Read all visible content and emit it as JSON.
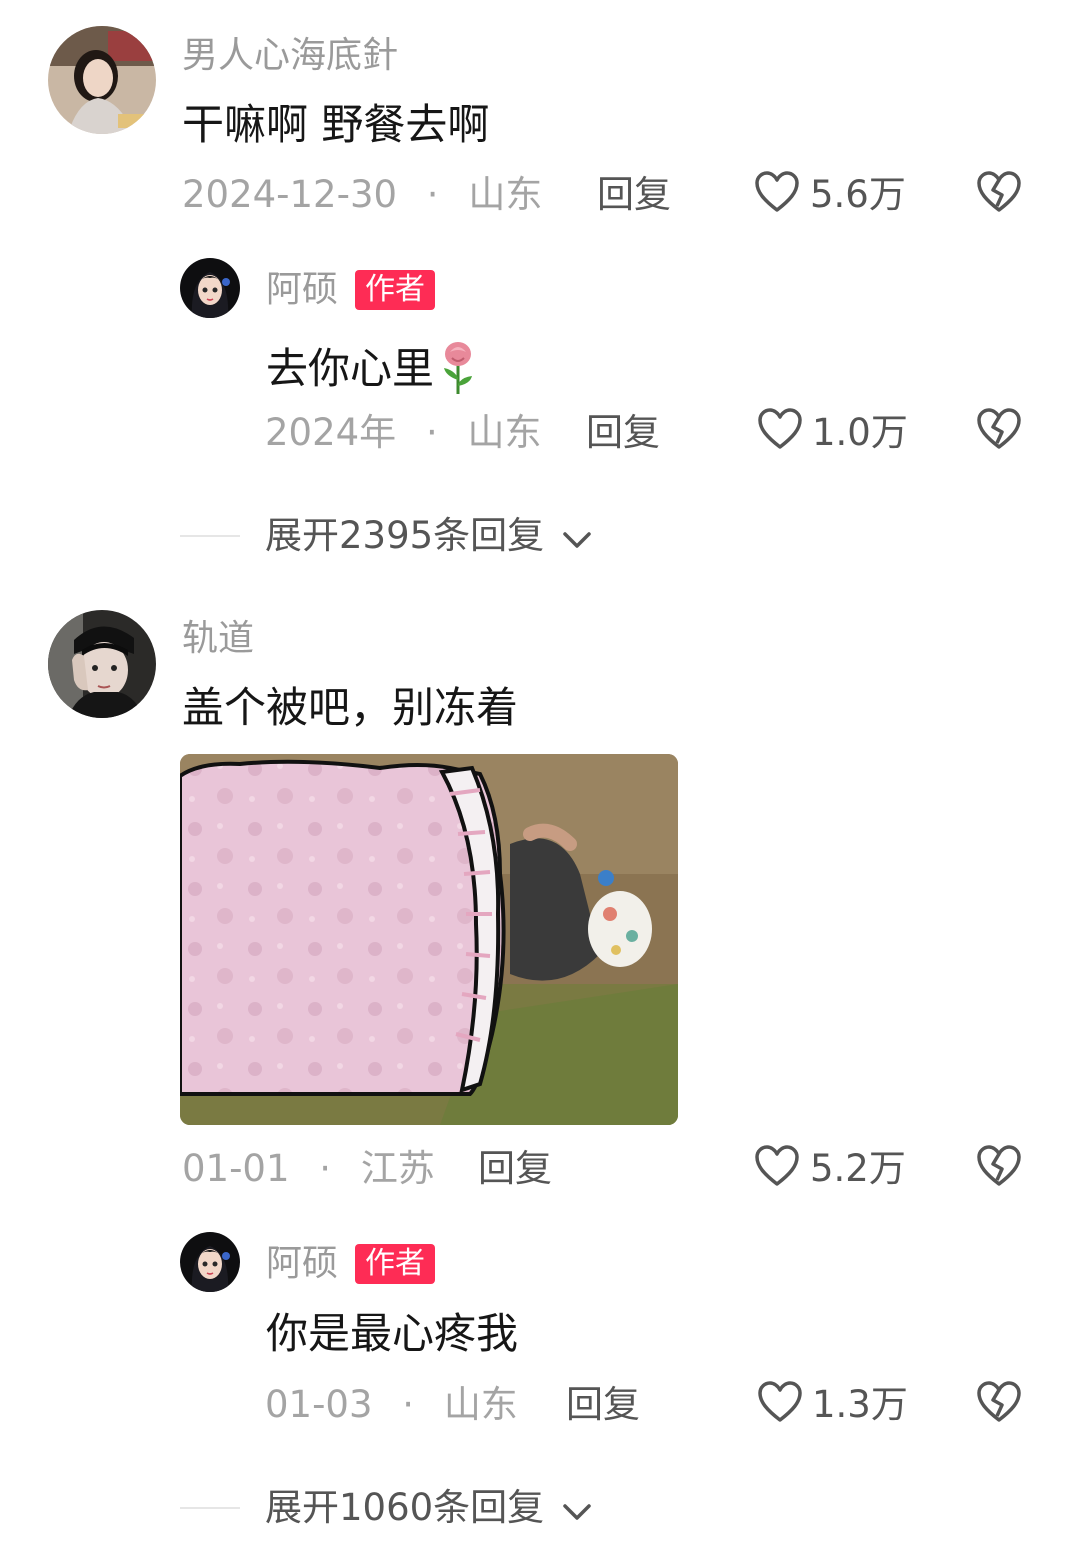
{
  "comments": [
    {
      "username": "男人心海底針",
      "text": "干嘛啊 野餐去啊",
      "date": "2024-12-30",
      "location": "山东",
      "reply_label": "回复",
      "likes": "5.6万",
      "replies": [
        {
          "username": "阿硕",
          "badge": "作者",
          "text": "去你心里",
          "emoji": "rose",
          "date": "2024年",
          "location": "山东",
          "reply_label": "回复",
          "likes": "1.0万"
        }
      ],
      "expand_label": "展开2395条回复"
    },
    {
      "username": "轨道",
      "text": "盖个被吧，别冻着",
      "date": "01-01",
      "location": "江苏",
      "reply_label": "回复",
      "likes": "5.2万",
      "replies": [
        {
          "username": "阿硕",
          "badge": "作者",
          "text": "你是最心疼我",
          "date": "01-03",
          "location": "山东",
          "reply_label": "回复",
          "likes": "1.3万"
        }
      ],
      "expand_label": "展开1060条回复"
    }
  ],
  "separator": "·",
  "colors": {
    "badge": "#fe2c55",
    "muted": "#a4a4a4",
    "action": "#555555"
  },
  "icons": [
    "heart-icon",
    "dislike-heart-icon",
    "chevron-down-icon",
    "rose-emoji"
  ]
}
